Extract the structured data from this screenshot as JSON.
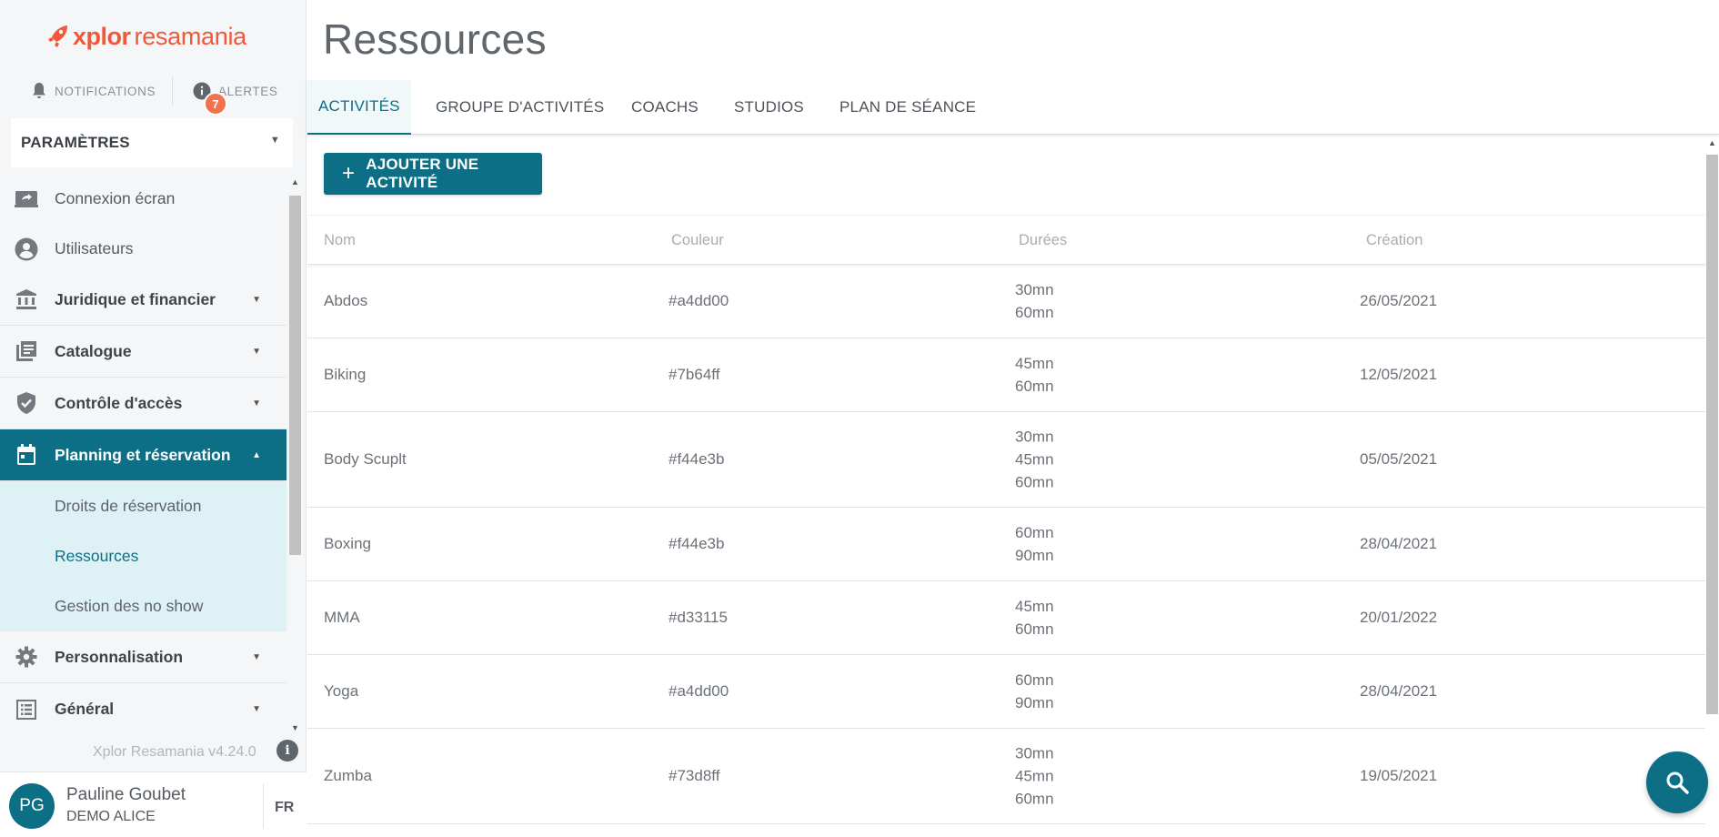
{
  "brand": {
    "part1": "xplor",
    "part2": "resamania",
    "color": "#f2573a"
  },
  "header": {
    "notifications_label": "NOTIFICATIONS",
    "alerts_label": "ALERTES",
    "alerts_count": "7"
  },
  "params": {
    "label": "PARAMÈTRES"
  },
  "sidebar": {
    "items": [
      {
        "label": "Connexion écran",
        "icon": "screen-share-icon"
      },
      {
        "label": "Utilisateurs",
        "icon": "user-circle-icon"
      },
      {
        "label": "Juridique et financier",
        "icon": "bank-icon"
      },
      {
        "label": "Catalogue",
        "icon": "catalog-icon"
      },
      {
        "label": "Contrôle d'accès",
        "icon": "shield-check-icon"
      },
      {
        "label": "Planning et réservation",
        "icon": "calendar-icon"
      },
      {
        "label": "Personnalisation",
        "icon": "gear-icon"
      },
      {
        "label": "Général",
        "icon": "list-icon"
      }
    ],
    "submenu": [
      {
        "label": "Droits de réservation"
      },
      {
        "label": "Ressources"
      },
      {
        "label": "Gestion des no show"
      }
    ]
  },
  "footer": {
    "version": "Xplor Resamania v4.24.0",
    "user_initials": "PG",
    "user_name": "Pauline Goubet",
    "user_org": "DEMO ALICE",
    "lang": "FR"
  },
  "page": {
    "title": "Ressources",
    "tabs": [
      {
        "label": "ACTIVITÉS"
      },
      {
        "label": "GROUPE D'ACTIVITÉS"
      },
      {
        "label": "COACHS"
      },
      {
        "label": "STUDIOS"
      },
      {
        "label": "PLAN DE SÉANCE"
      }
    ],
    "add_button": "AJOUTER UNE ACTIVITÉ"
  },
  "table": {
    "columns": [
      "Nom",
      "Couleur",
      "Durées",
      "Création"
    ],
    "rows": [
      {
        "name": "Abdos",
        "color": "#a4dd00",
        "durations": "30mn\n60mn",
        "created": "26/05/2021"
      },
      {
        "name": "Biking",
        "color": "#7b64ff",
        "durations": "45mn\n60mn",
        "created": "12/05/2021"
      },
      {
        "name": "Body Scuplt",
        "color": "#f44e3b",
        "durations": "30mn\n45mn\n60mn",
        "created": "05/05/2021"
      },
      {
        "name": "Boxing",
        "color": "#f44e3b",
        "durations": "60mn\n90mn",
        "created": "28/04/2021"
      },
      {
        "name": "MMA",
        "color": "#d33115",
        "durations": "45mn\n60mn",
        "created": "20/01/2022"
      },
      {
        "name": "Yoga",
        "color": "#a4dd00",
        "durations": "60mn\n90mn",
        "created": "28/04/2021"
      },
      {
        "name": "Zumba",
        "color": "#73d8ff",
        "durations": "30mn\n45mn\n60mn",
        "created": "19/05/2021"
      }
    ]
  },
  "theme": {
    "accent": "#0c6f86",
    "badge": "#f2724f",
    "submenu_bg": "#def2f5"
  }
}
